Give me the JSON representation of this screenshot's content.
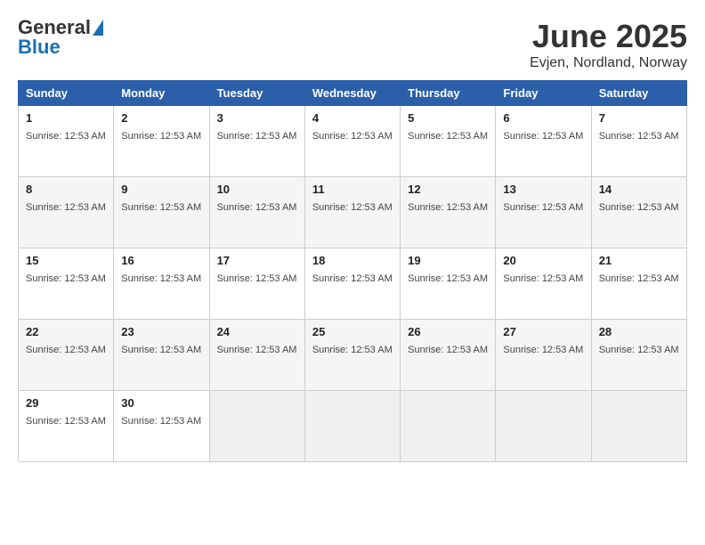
{
  "logo": {
    "general": "General",
    "blue": "Blue"
  },
  "title": "June 2025",
  "subtitle": "Evjen, Nordland, Norway",
  "days_of_week": [
    "Sunday",
    "Monday",
    "Tuesday",
    "Wednesday",
    "Thursday",
    "Friday",
    "Saturday"
  ],
  "sunrise_text": "Sunrise: 12:53 AM",
  "weeks": [
    [
      {
        "day": "1",
        "info": "Sunrise: 12:53 AM"
      },
      {
        "day": "2",
        "info": "Sunrise: 12:53 AM"
      },
      {
        "day": "3",
        "info": "Sunrise: 12:53 AM"
      },
      {
        "day": "4",
        "info": "Sunrise: 12:53 AM"
      },
      {
        "day": "5",
        "info": "Sunrise: 12:53 AM"
      },
      {
        "day": "6",
        "info": "Sunrise: 12:53 AM"
      },
      {
        "day": "7",
        "info": "Sunrise: 12:53 AM"
      }
    ],
    [
      {
        "day": "8",
        "info": "Sunrise: 12:53 AM"
      },
      {
        "day": "9",
        "info": "Sunrise: 12:53 AM"
      },
      {
        "day": "10",
        "info": "Sunrise: 12:53 AM"
      },
      {
        "day": "11",
        "info": "Sunrise: 12:53 AM"
      },
      {
        "day": "12",
        "info": "Sunrise: 12:53 AM"
      },
      {
        "day": "13",
        "info": "Sunrise: 12:53 AM"
      },
      {
        "day": "14",
        "info": "Sunrise: 12:53 AM"
      }
    ],
    [
      {
        "day": "15",
        "info": "Sunrise: 12:53 AM"
      },
      {
        "day": "16",
        "info": "Sunrise: 12:53 AM"
      },
      {
        "day": "17",
        "info": "Sunrise: 12:53 AM"
      },
      {
        "day": "18",
        "info": "Sunrise: 12:53 AM"
      },
      {
        "day": "19",
        "info": "Sunrise: 12:53 AM"
      },
      {
        "day": "20",
        "info": "Sunrise: 12:53 AM"
      },
      {
        "day": "21",
        "info": "Sunrise: 12:53 AM"
      }
    ],
    [
      {
        "day": "22",
        "info": "Sunrise: 12:53 AM"
      },
      {
        "day": "23",
        "info": "Sunrise: 12:53 AM"
      },
      {
        "day": "24",
        "info": "Sunrise: 12:53 AM"
      },
      {
        "day": "25",
        "info": "Sunrise: 12:53 AM"
      },
      {
        "day": "26",
        "info": "Sunrise: 12:53 AM"
      },
      {
        "day": "27",
        "info": "Sunrise: 12:53 AM"
      },
      {
        "day": "28",
        "info": "Sunrise: 12:53 AM"
      }
    ],
    [
      {
        "day": "29",
        "info": "Sunrise: 12:53 AM"
      },
      {
        "day": "30",
        "info": "Sunrise: 12:53 AM"
      },
      null,
      null,
      null,
      null,
      null
    ]
  ]
}
